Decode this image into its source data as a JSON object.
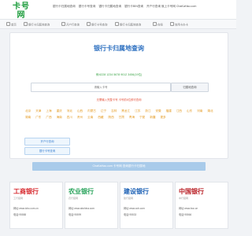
{
  "logo": {
    "cn": "卡号网",
    "en": "ChaKaHao.com"
  },
  "top_links": [
    "银行卡归属地查询",
    "银行卡号查询",
    "银行卡归属地查询",
    "银行卡BIN查询",
    "开户行查询 就上卡号网 ChaKaHao.com"
  ],
  "nav": [
    "首页",
    "银行卡归属地查询",
    "开户行查询",
    "银行卡号查询",
    "银行卡归属地查询",
    "在线",
    "信用卡办卡"
  ],
  "main": {
    "title": "银行卡归属地查询",
    "example": "例:6228 1234 5678 9012 3456(19位)",
    "search_placeholder": "请输入卡号",
    "search_button": "归属地查询",
    "tip": "无需输入完整卡号,卡号前6位即可查询",
    "cities": [
      "北京",
      "天津",
      "上海",
      "重庆",
      "河北",
      "山西",
      "内蒙古",
      "辽宁",
      "吉林",
      "黑龙江",
      "江苏",
      "浙江",
      "安徽",
      "福建",
      "江西",
      "山东",
      "河南",
      "湖北",
      "湖南",
      "广东",
      "广西",
      "海南",
      "四川",
      "贵州",
      "云南",
      "西藏",
      "陕西",
      "甘肃",
      "青海",
      "宁夏",
      "新疆",
      "更多"
    ],
    "button_1": "开户行查询",
    "button_2": "银行卡号查询",
    "banner": "ChaKaHao.com 卡号网 查询银行卡归属地"
  },
  "banks": [
    {
      "name": "工商银行",
      "sub": "工行官网",
      "site_label": "网址:",
      "site": "www.icbc.com.cn",
      "phone_label": "电话:",
      "phone": "95588",
      "color": "#d6262b"
    },
    {
      "name": "农业银行",
      "sub": "农行官网",
      "site_label": "网址:",
      "site": "www.abchina.com",
      "phone_label": "电话:",
      "phone": "95599",
      "color": "#27a35a"
    },
    {
      "name": "建设银行",
      "sub": "建行官网",
      "site_label": "网址:",
      "site": "www.ccb.com",
      "phone_label": "电话:",
      "phone": "95533",
      "color": "#1a5fb4"
    },
    {
      "name": "中国银行",
      "sub": "中行官网",
      "site_label": "网址:",
      "site": "www.boc.cn",
      "phone_label": "电话:",
      "phone": "95566",
      "color": "#b81c22"
    }
  ]
}
